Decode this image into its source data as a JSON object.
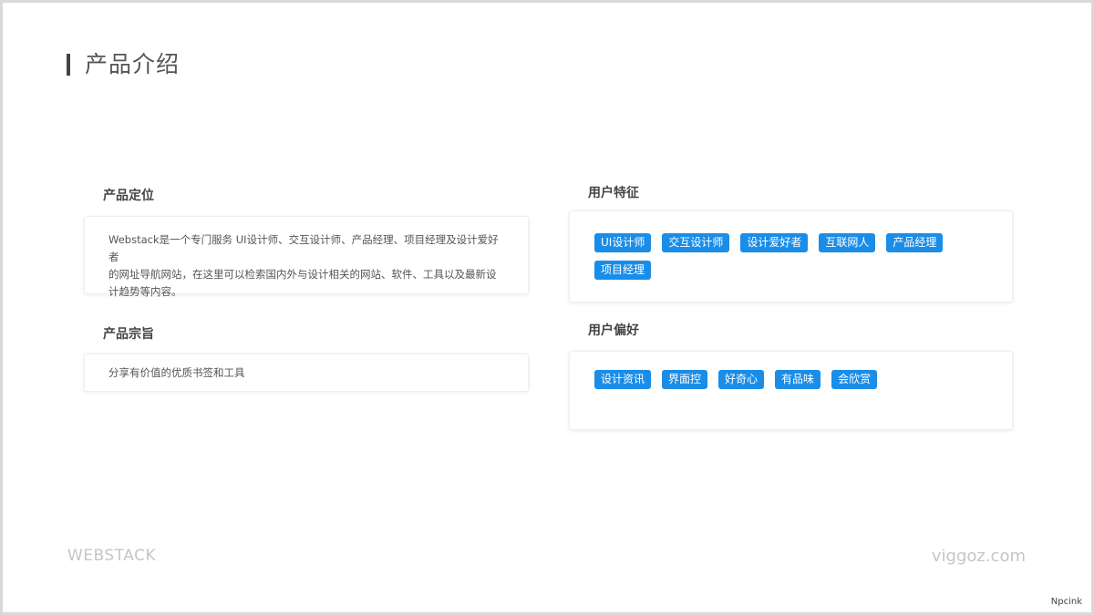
{
  "page": {
    "title": "产品介绍"
  },
  "positioning": {
    "heading": "产品定位",
    "lines": [
      "Webstack是一个专门服务 UI设计师、交互设计师、产品经理、项目经理及设计爱好者",
      "的网址导航网站，在这里可以检索国内外与设计相关的网站、软件、工具以及最新设",
      "计趋势等内容。"
    ]
  },
  "purpose": {
    "heading": "产品宗旨",
    "text": "分享有价值的优质书签和工具"
  },
  "user_traits": {
    "heading": "用户特征",
    "tags": [
      "UI设计师",
      "交互设计师",
      "设计爱好者",
      "互联网人",
      "产品经理",
      "项目经理"
    ]
  },
  "user_prefs": {
    "heading": "用户偏好",
    "tags": [
      "设计资讯",
      "界面控",
      "好奇心",
      "有品味",
      "会欣赏"
    ]
  },
  "footer": {
    "brand": "WEBSTACK",
    "site": "viggoz.com",
    "watermark": "Npcink"
  },
  "colors": {
    "tag_bg": "#1a8de8",
    "title_bar": "#444444"
  }
}
